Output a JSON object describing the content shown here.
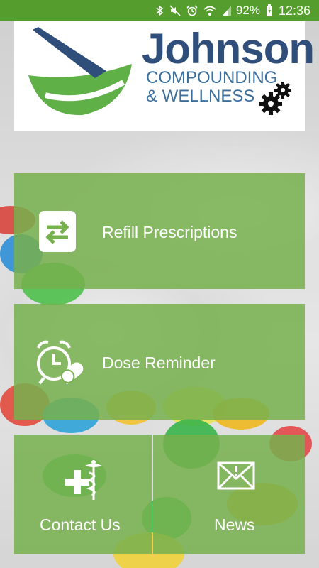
{
  "status_bar": {
    "battery_percent": "92%",
    "time": "12:36",
    "icons": [
      "bluetooth-icon",
      "mute-icon",
      "alarm-icon",
      "wifi-icon",
      "signal-icon",
      "battery-charging-icon"
    ]
  },
  "header": {
    "brand_name": "Johnson",
    "brand_line1": "COMPOUNDING",
    "brand_line2": "& WELLNESS",
    "logo_icon": "mortar-pestle-icon",
    "settings_icon": "gears-icon"
  },
  "tiles": [
    {
      "id": "refill",
      "label": "Refill Prescriptions",
      "icon": "refill-exchange-icon"
    },
    {
      "id": "dose",
      "label": "Dose Reminder",
      "icon": "alarm-pill-icon"
    },
    {
      "id": "contact",
      "label": "Contact Us",
      "icon": "medical-caduceus-icon"
    },
    {
      "id": "news",
      "label": "News",
      "icon": "envelope-alert-icon"
    }
  ],
  "colors": {
    "status_bar": "#559e2d",
    "tile_green": "#77b04e",
    "brand_blue": "#2f4f7a",
    "logo_green": "#5fb046"
  }
}
